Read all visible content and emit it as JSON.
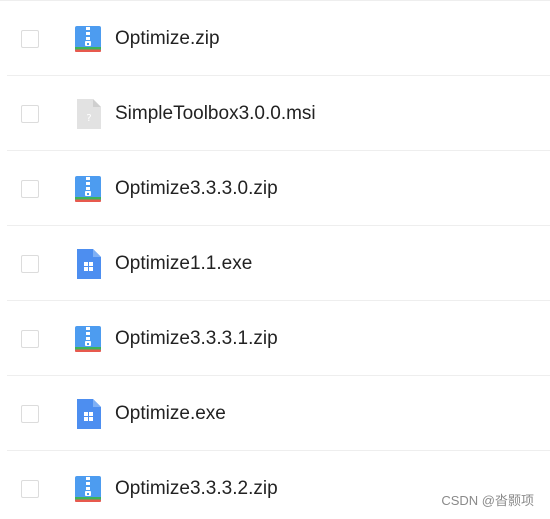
{
  "files": [
    {
      "name": "Optimize.zip",
      "icon": "zip-archive-icon"
    },
    {
      "name": "SimpleToolbox3.0.0.msi",
      "icon": "unknown-file-icon"
    },
    {
      "name": "Optimize3.3.3.0.zip",
      "icon": "zip-archive-icon"
    },
    {
      "name": "Optimize1.1.exe",
      "icon": "exe-file-icon"
    },
    {
      "name": "Optimize3.3.3.1.zip",
      "icon": "zip-archive-icon"
    },
    {
      "name": "Optimize.exe",
      "icon": "exe-file-icon"
    },
    {
      "name": "Optimize3.3.3.2.zip",
      "icon": "zip-archive-icon"
    }
  ],
  "watermark": "CSDN @沓颢项",
  "colors": {
    "zip_blue": "#4d9cf0",
    "zip_stripe_green": "#3cb35a",
    "zip_stripe_red": "#e8594d",
    "exe_blue": "#4d8ef0",
    "unknown_gray": "#e2e2e2",
    "text": "#222222",
    "divider": "#eeeeee"
  }
}
